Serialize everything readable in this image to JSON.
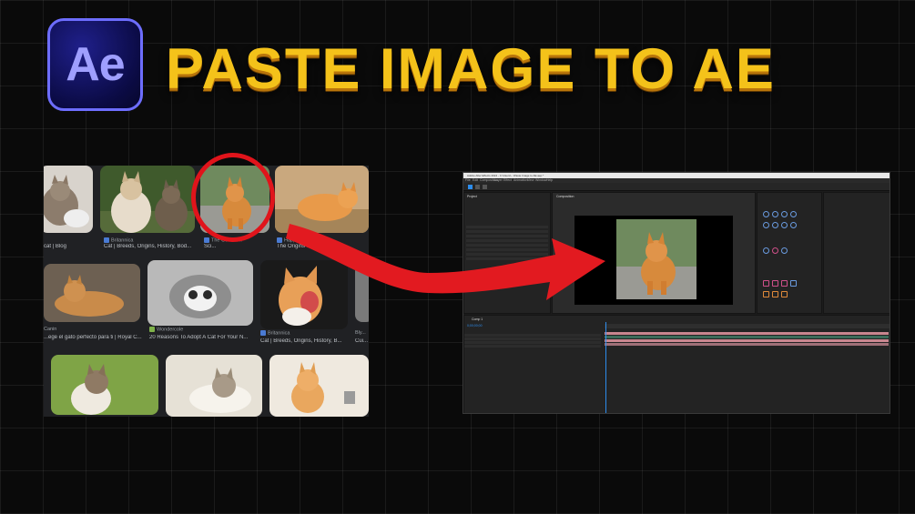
{
  "logo": {
    "text": "Ae"
  },
  "title": "PASTE IMAGE TO AE",
  "search_results": {
    "row1": [
      {
        "caption": "cat | Blog",
        "source": ""
      },
      {
        "caption": "Cat | Breeds, Origins, History, Bod...",
        "source": "Britannica"
      },
      {
        "caption": "Sci...",
        "source": "The Guardian"
      },
      {
        "caption": "The Origins of Cats | Sm...",
        "source": "Happy Paws P..."
      }
    ],
    "row2": [
      {
        "caption": "...ege el gato perfecto para ti | Royal C...",
        "source": "Canin"
      },
      {
        "caption": "20 Reasons To Adopt A Cat For Your N...",
        "source": "Wondercole"
      },
      {
        "caption": "Cat | Breeds, Origins, History, B...",
        "source": "Britannica"
      },
      {
        "caption": "Cui...",
        "source": "Bly..."
      }
    ]
  },
  "ae_window": {
    "title": "Adobe After Effects 2024 - C:\\Users\\...\\Paste Image to AE.aep *",
    "menu": [
      "File",
      "Edit",
      "Composition",
      "Layer",
      "Effect",
      "Animation",
      "View",
      "Window",
      "Help"
    ],
    "project_label": "Project",
    "composition_label": "Composition",
    "timeline_tab": "Comp 1",
    "timecode": "0;00;00;00",
    "colors": {
      "bg": "#1c1c1c",
      "track_pink": "#c9868f",
      "track_green": "#3d6b5a",
      "accent_blue": "#2d8ceb"
    }
  },
  "arrow_color": "#e21a20"
}
